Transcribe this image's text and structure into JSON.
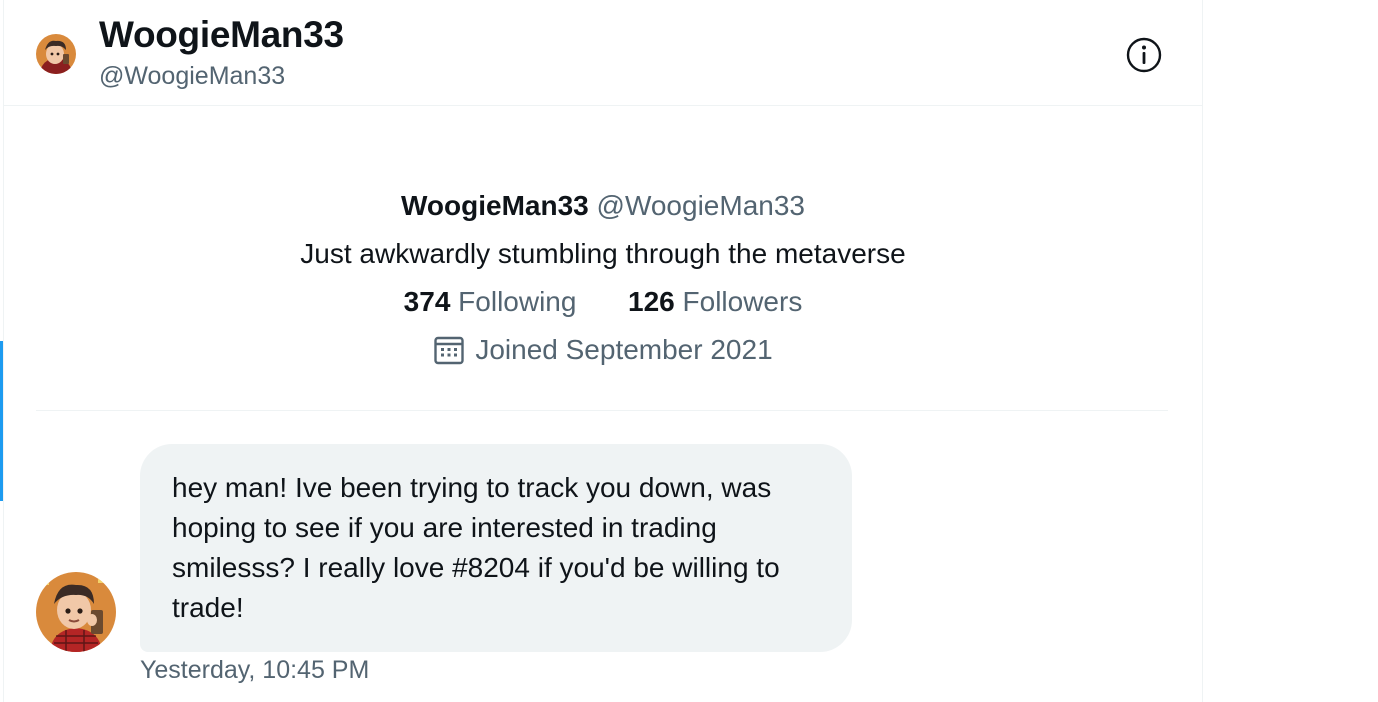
{
  "header": {
    "title": "WoogieMan33",
    "handle": "@WoogieMan33",
    "info_icon": "info-icon"
  },
  "profile": {
    "name": "WoogieMan33",
    "handle": "@WoogieMan33",
    "bio": "Just awkwardly stumbling through the metaverse",
    "following_count": "374",
    "following_label": "Following",
    "followers_count": "126",
    "followers_label": "Followers",
    "joined": "Joined September 2021",
    "joined_icon": "calendar-icon"
  },
  "message": {
    "text": "hey man! Ive been trying to track you down, was hoping to see if you are interested in trading smilesss? I really love #8204 if you'd be willing to trade!",
    "timestamp": "Yesterday, 10:45 PM"
  },
  "colors": {
    "accent": "#1d9bf0",
    "secondary_text": "#536471",
    "bubble": "#eff3f4",
    "primary_text": "#0f1419"
  }
}
